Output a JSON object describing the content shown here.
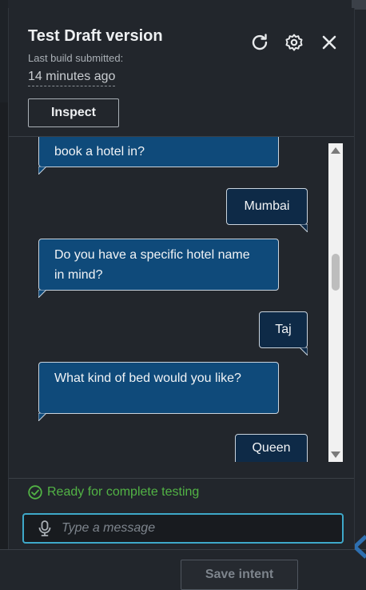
{
  "panel": {
    "title": "Test Draft version",
    "subtitle": "Last build submitted:",
    "time": "14 minutes ago",
    "inspect_label": "Inspect",
    "icons": [
      "refresh-icon",
      "settings-icon",
      "close-icon"
    ]
  },
  "chat": {
    "messages": [
      {
        "from": "bot",
        "text": "book a hotel in?"
      },
      {
        "from": "user",
        "text": "Mumbai"
      },
      {
        "from": "bot",
        "text": "Do you have a specific hotel name in mind?"
      },
      {
        "from": "user",
        "text": "Taj"
      },
      {
        "from": "bot",
        "text": "What kind of bed would you like?"
      },
      {
        "from": "user",
        "text": "Queen"
      }
    ]
  },
  "status": {
    "text": "Ready for complete testing",
    "color": "#52b345"
  },
  "input": {
    "placeholder": "Type a message",
    "value": ""
  },
  "footer": {
    "save_label": "Save intent"
  },
  "colors": {
    "accent": "#3ea8c9",
    "bot_bubble": "#0f4a7a",
    "user_bubble": "#0e2a47"
  }
}
